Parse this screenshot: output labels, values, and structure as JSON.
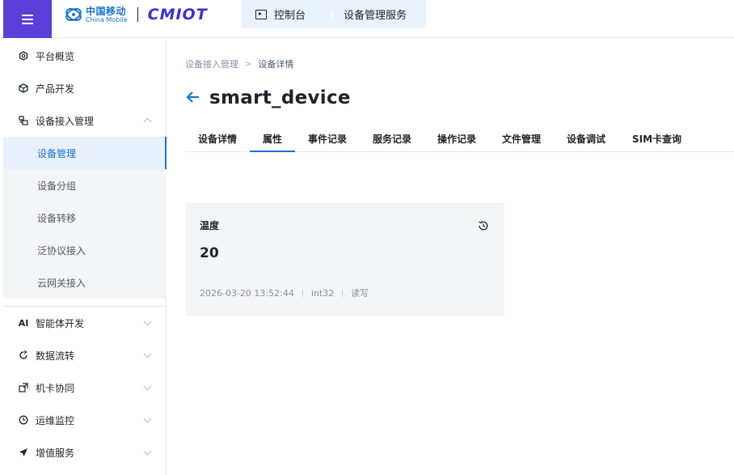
{
  "header": {
    "brand_zh": "中国移动",
    "brand_en": "China Mobile",
    "product_logo": "CMIOT",
    "tabs": [
      {
        "label": "控制台",
        "icon": "console-icon"
      },
      {
        "label": "设备管理服务"
      }
    ],
    "accent_color": "#5a3fd8"
  },
  "sidebar": {
    "items": [
      {
        "label": "平台概览",
        "icon": "overview-icon"
      },
      {
        "label": "产品开发",
        "icon": "cube-icon"
      },
      {
        "label": "设备接入管理",
        "icon": "device-access-icon",
        "expanded": true
      },
      {
        "label": "设备管理",
        "active": true
      },
      {
        "label": "设备分组"
      },
      {
        "label": "设备转移"
      },
      {
        "label": "泛协议接入"
      },
      {
        "label": "云网关接入"
      },
      {
        "label": "智能体开发",
        "icon": "ai-icon"
      },
      {
        "label": "数据流转",
        "icon": "data-flow-icon"
      },
      {
        "label": "机卡协同",
        "icon": "card-sync-icon"
      },
      {
        "label": "运维监控",
        "icon": "monitor-icon"
      },
      {
        "label": "增值服务",
        "icon": "value-added-icon"
      }
    ],
    "ai_glyph": "AI"
  },
  "main": {
    "breadcrumb": [
      "设备接入管理",
      "设备详情"
    ],
    "breadcrumb_sep": ">",
    "title": "smart_device",
    "tabs": [
      "设备详情",
      "属性",
      "事件记录",
      "服务记录",
      "操作记录",
      "文件管理",
      "设备调试",
      "SIM卡查询"
    ],
    "active_tab": "属性",
    "property": {
      "name": "温度",
      "value": "20",
      "timestamp": "2026-03-20 13:52:44",
      "data_type": "int32",
      "access": "读写"
    }
  }
}
